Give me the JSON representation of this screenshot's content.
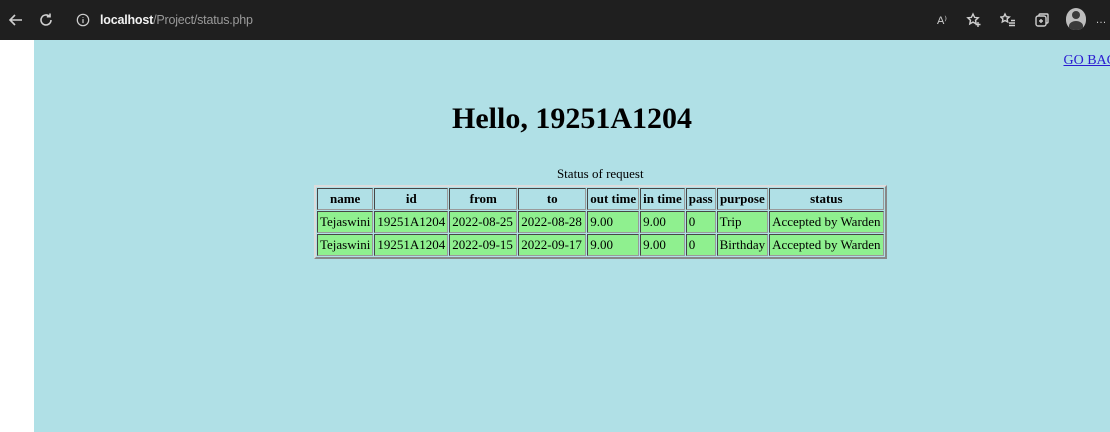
{
  "browser": {
    "url_host": "localhost",
    "url_path": "/Project/status.php",
    "read_aloud_label": "A⁾",
    "more_label": "…"
  },
  "page": {
    "go_back": "GO BAC",
    "greeting": "Hello, 19251A1204",
    "bg_color": "#b0e0e6"
  },
  "status_table": {
    "caption": "Status of request",
    "headers": [
      "name",
      "id",
      "from",
      "to",
      "out time",
      "in time",
      "pass",
      "purpose",
      "status"
    ],
    "rows": [
      [
        "Tejaswini",
        "19251A1204",
        "2022-08-25",
        "2022-08-28",
        "9.00",
        "9.00",
        "0",
        "Trip",
        "Accepted by Warden"
      ],
      [
        "Tejaswini",
        "19251A1204",
        "2022-09-15",
        "2022-09-17",
        "9.00",
        "9.00",
        "0",
        "Birthday",
        "Accepted by Warden"
      ]
    ],
    "row_color": "#8ff08f"
  }
}
